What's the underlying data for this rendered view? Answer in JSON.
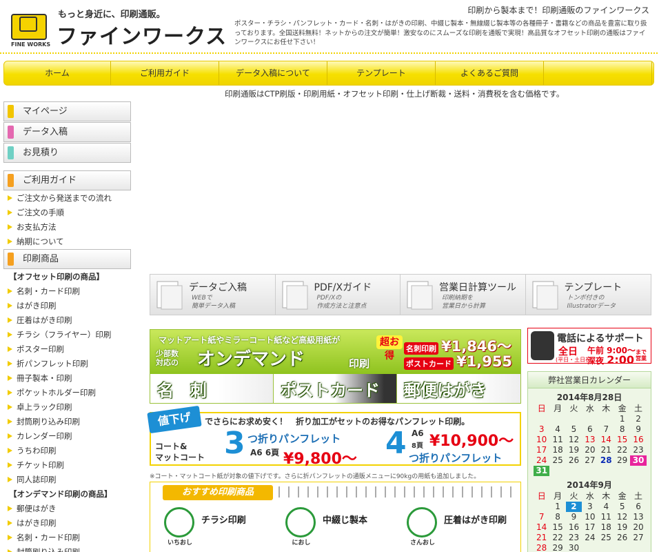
{
  "header": {
    "logo_text": "FINE WORKS",
    "tagline": "もっと身近に、印刷通販。",
    "brand": "ファインワークス",
    "catch": "印刷から製本まで！印刷通販のファインワークス",
    "description": "ポスター・チラシ・パンフレット・カード・名刺・はがきの印刷、中綴じ製本・無線綴じ製本等の各種冊子・書籍などの商品を豊富に取り扱っております。全国送料無料！ネットからの注文が簡単！激安なのにスムーズな印刷を通販で実現！高品質なオフセット印刷の通販はファインワークスにお任せ下さい！"
  },
  "nav": {
    "items": [
      "ホーム",
      "ご利用ガイド",
      "データ入稿について",
      "テンプレート",
      "よくあるご質問",
      ""
    ],
    "note": "印刷通販はCTP刷版・印刷用紙・オフセット印刷・仕上げ断裁・送料・消費税を含む価格です。"
  },
  "sidebar": {
    "top_buttons": [
      {
        "label": "マイページ",
        "color": "#f2c500"
      },
      {
        "label": "データ入稿",
        "color": "#e468b0"
      },
      {
        "label": "お見積り",
        "color": "#6fd0c4"
      }
    ],
    "guide_title": "ご利用ガイド",
    "guide_links": [
      "ご注文から発送までの流れ",
      "ご注文の手順",
      "お支払方法",
      "納期について"
    ],
    "products_title": "印刷商品",
    "offset_title": "【オフセット印刷の商品】",
    "offset_links": [
      "名刺・カード印刷",
      "はがき印刷",
      "圧着はがき印刷",
      "チラシ（フライヤー）印刷",
      "ポスター印刷",
      "折パンフレット印刷",
      "冊子製本・印刷",
      "ポケットホルダー印刷",
      "卓上ラック印刷",
      "封筒刷り込み印刷",
      "カレンダー印刷",
      "うちわ印刷",
      "チケット印刷",
      "同人誌印刷"
    ],
    "ondemand_title": "【オンデマンド印刷の商品】",
    "ondemand_links": [
      "郵便はがき",
      "はがき印刷",
      "名刺・カード印刷",
      "封筒刷り込み印刷"
    ]
  },
  "quick_links": [
    {
      "title": "データご入稿",
      "sub1": "WEBで",
      "sub2": "簡単データ入稿",
      "icon": "data-upload-icon"
    },
    {
      "title": "PDF/Xガイド",
      "sub1": "PDF/Xの",
      "sub2": "作成方法と注意点",
      "icon": "pdf-icon"
    },
    {
      "title": "営業日計算ツール",
      "sub1": "印刷納期を",
      "sub2": "営業日から計算",
      "icon": "calendar-calc-icon"
    },
    {
      "title": "テンプレート",
      "sub1": "トンボ付きの",
      "sub2": "Illustratorデータ",
      "icon": "template-icon"
    }
  ],
  "ondemand": {
    "line1": "マットアート紙やミラーコート紙など高級用紙が",
    "toku": "超お得",
    "small1": "少部数",
    "small2": "対応の",
    "big": "オンデマンド",
    "insatsu": "印刷",
    "price1_label": "名刺印刷",
    "price1": "¥1,846～",
    "price2_label": "ポストカード",
    "price2": "¥1,955～",
    "cells": [
      "名　刺",
      "ポストカード",
      "郵便はがき"
    ]
  },
  "pamphlet": {
    "sale": "値下げ",
    "top": "でさらにお求め安く！　折り加工がセットのお得なパンフレット印刷。",
    "paper1": "コート&",
    "paper2": "マットコート",
    "num3": "3",
    "txt3": "つ折りパンフレット",
    "size3": "A6 6頁",
    "price3": "¥9,800～",
    "num4": "4",
    "size4a": "A6",
    "size4b": "8頁",
    "price4": "¥10,900～",
    "txt4": "つ折りパンフレット",
    "note": "※コート・マットコート紙が対象の値下げです。さらに折パンフレットの通販メニューに90kgの用紙も追加しました。"
  },
  "recommend": {
    "head": "おすすめ印刷商品",
    "items": [
      {
        "title": "チラシ印刷",
        "badge": "いちおし"
      },
      {
        "title": "中綴じ製本",
        "badge": "におし"
      },
      {
        "title": "圧着はがき印刷",
        "badge": "さんおし"
      }
    ]
  },
  "phone": {
    "title": "電話によるサポート",
    "allday": "全日",
    "allday_sub": "(平日・土日祝)",
    "time1": "午前 9:00～",
    "time2_prefix": "深夜",
    "time2": "2:00",
    "tail": "まで営業"
  },
  "calendar": {
    "title": "弊社営業日カレンダー",
    "weekdays": [
      "日",
      "月",
      "火",
      "水",
      "木",
      "金",
      "土"
    ],
    "months": [
      {
        "label": "2014年8月28日",
        "cells": [
          {
            "d": "",
            "c": ""
          },
          {
            "d": "",
            "c": ""
          },
          {
            "d": "",
            "c": ""
          },
          {
            "d": "",
            "c": ""
          },
          {
            "d": "",
            "c": ""
          },
          {
            "d": "1",
            "c": ""
          },
          {
            "d": "2",
            "c": ""
          },
          {
            "d": "3",
            "c": ""
          },
          {
            "d": "4",
            "c": ""
          },
          {
            "d": "5",
            "c": ""
          },
          {
            "d": "6",
            "c": ""
          },
          {
            "d": "7",
            "c": ""
          },
          {
            "d": "8",
            "c": ""
          },
          {
            "d": "9",
            "c": ""
          },
          {
            "d": "10",
            "c": ""
          },
          {
            "d": "11",
            "c": ""
          },
          {
            "d": "12",
            "c": ""
          },
          {
            "d": "13",
            "c": "hol"
          },
          {
            "d": "14",
            "c": "hol"
          },
          {
            "d": "15",
            "c": "hol"
          },
          {
            "d": "16",
            "c": "hol"
          },
          {
            "d": "17",
            "c": "hol"
          },
          {
            "d": "18",
            "c": ""
          },
          {
            "d": "19",
            "c": ""
          },
          {
            "d": "20",
            "c": ""
          },
          {
            "d": "21",
            "c": ""
          },
          {
            "d": "22",
            "c": ""
          },
          {
            "d": "23",
            "c": ""
          },
          {
            "d": "24",
            "c": ""
          },
          {
            "d": "25",
            "c": ""
          },
          {
            "d": "26",
            "c": ""
          },
          {
            "d": "27",
            "c": ""
          },
          {
            "d": "28",
            "c": "today"
          },
          {
            "d": "29",
            "c": ""
          },
          {
            "d": "30",
            "c": "off-pink"
          },
          {
            "d": "31",
            "c": "off-green"
          }
        ]
      },
      {
        "label": "2014年9月",
        "cells": [
          {
            "d": "",
            "c": ""
          },
          {
            "d": "1",
            "c": ""
          },
          {
            "d": "2",
            "c": "off-blue"
          },
          {
            "d": "3",
            "c": ""
          },
          {
            "d": "4",
            "c": ""
          },
          {
            "d": "5",
            "c": ""
          },
          {
            "d": "6",
            "c": ""
          },
          {
            "d": "7",
            "c": ""
          },
          {
            "d": "8",
            "c": ""
          },
          {
            "d": "9",
            "c": ""
          },
          {
            "d": "10",
            "c": ""
          },
          {
            "d": "11",
            "c": ""
          },
          {
            "d": "12",
            "c": ""
          },
          {
            "d": "13",
            "c": ""
          },
          {
            "d": "14",
            "c": ""
          },
          {
            "d": "15",
            "c": ""
          },
          {
            "d": "16",
            "c": ""
          },
          {
            "d": "17",
            "c": ""
          },
          {
            "d": "18",
            "c": ""
          },
          {
            "d": "19",
            "c": ""
          },
          {
            "d": "20",
            "c": ""
          },
          {
            "d": "21",
            "c": ""
          },
          {
            "d": "22",
            "c": ""
          },
          {
            "d": "23",
            "c": ""
          },
          {
            "d": "24",
            "c": ""
          },
          {
            "d": "25",
            "c": ""
          },
          {
            "d": "26",
            "c": ""
          },
          {
            "d": "27",
            "c": ""
          },
          {
            "d": "28",
            "c": ""
          },
          {
            "d": "29",
            "c": ""
          },
          {
            "d": "30",
            "c": ""
          }
        ]
      }
    ]
  }
}
